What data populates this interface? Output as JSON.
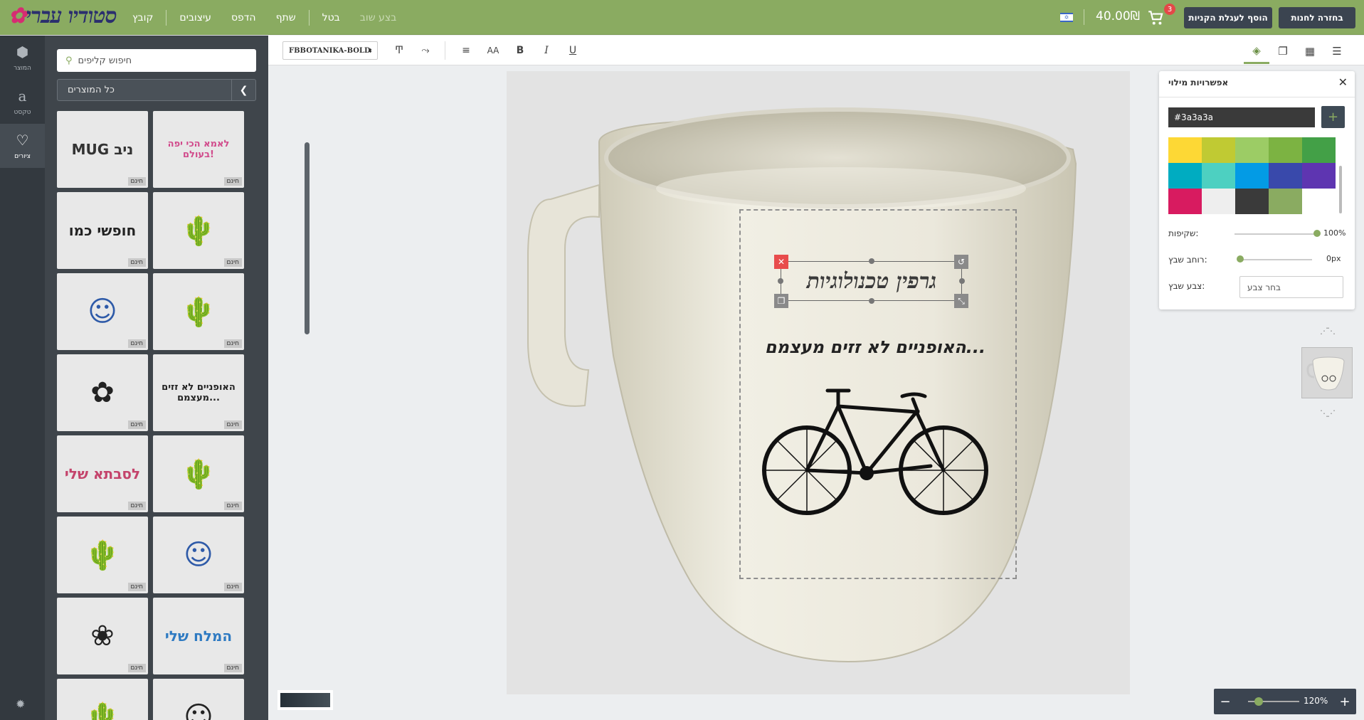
{
  "header": {
    "logo": "סטודיו עברי",
    "menu": [
      "קובץ",
      "עיצובים",
      "הדפס",
      "שתף",
      "בטל",
      "בצע שוב"
    ],
    "back_to_store": "בחזרה לחנות",
    "add_to_cart": "הוסף לעגלת הקניות",
    "cart_count": "3",
    "price": "40.00₪"
  },
  "leftnav": {
    "items": [
      {
        "label": "המוצר",
        "icon": "cube-icon"
      },
      {
        "label": "טקסט",
        "icon": "text-icon"
      },
      {
        "label": "ציורים",
        "icon": "heart-icon"
      }
    ]
  },
  "clips": {
    "search_placeholder": "חיפוש קליפים",
    "filter": "כל המוצרים",
    "free_label": "חינם",
    "items": [
      {
        "text": "MUG ניב",
        "color": "#333333"
      },
      {
        "text": "לאמא הכי יפה בעולם!",
        "color": "#d14a8b"
      },
      {
        "text": "חופשי כמו",
        "color": "#222222"
      },
      {
        "text": "🌵",
        "color": "#222222"
      },
      {
        "text": "☺",
        "color": "#2e5aa8"
      },
      {
        "text": "🌵",
        "color": "#222222"
      },
      {
        "text": "✿",
        "color": "#222222"
      },
      {
        "text": "האופניים לא זזים מעצמם...",
        "color": "#222222"
      },
      {
        "text": "לסבתא שלי",
        "color": "#c4436b"
      },
      {
        "text": "🌵",
        "color": "#222222"
      },
      {
        "text": "🌵",
        "color": "#222222"
      },
      {
        "text": "☺",
        "color": "#2e5aa8"
      },
      {
        "text": "❀",
        "color": "#222222"
      },
      {
        "text": "המלח שלי",
        "color": "#2e7ac2"
      },
      {
        "text": "🌵",
        "color": "#222222"
      },
      {
        "text": "☺",
        "color": "#222222"
      }
    ]
  },
  "toolbar": {
    "font": "FBBOTANIKA-BOLD"
  },
  "canvas": {
    "title_text": "גרפין טכנולוגיות",
    "line_text": "האופניים לא זזים מעצמם..."
  },
  "fill_panel": {
    "title": "אפשרויות מילוי",
    "hex": "#3a3a3a",
    "swatches": [
      "#fdd835",
      "#c0ca33",
      "#9ccc65",
      "#7cb342",
      "#43a047",
      "#00acc1",
      "#4dd0c1",
      "#039be5",
      "#3949ab",
      "#5e35b1",
      "#d81b60",
      "#eeeeee",
      "#3a3a3a",
      "#8aab61",
      "#ffffff"
    ],
    "opacity_label": "שקיפות:",
    "opacity_value": "100%",
    "opacity": 1.0,
    "stroke_width_label": "רוחב שבץ:",
    "stroke_width_value": "0px",
    "stroke_color_label": "צבע שבץ:",
    "stroke_color_placeholder": "בחר צבע"
  },
  "zoom": {
    "value": "120%"
  }
}
